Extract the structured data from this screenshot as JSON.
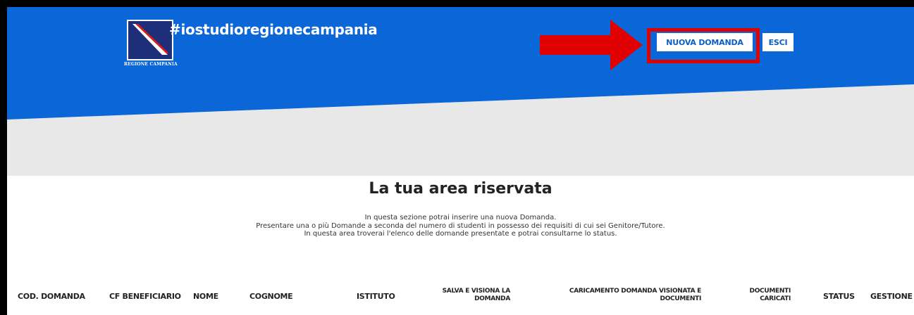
{
  "header": {
    "logo_text": "REGIONE CAMPANIA",
    "hashtag": "#iostudioregionecampania",
    "buttons": {
      "nuova_domanda": "NUOVA DOMANDA",
      "esci": "ESCI"
    }
  },
  "main": {
    "title": "La tua area riservata",
    "intro_lines": [
      "In questa sezione potrai inserire una nuova Domanda.",
      "Presentare una o più Domande a seconda del numero di studenti in possesso dei requisiti di cui sei Genitore/Tutore.",
      "In questa area troverai l'elenco delle domande presentate e potrai consultarne lo status."
    ]
  },
  "table": {
    "columns": {
      "cod_domanda": "COD. DOMANDA",
      "cf_beneficiario": "CF BENEFICIARIO",
      "nome": "NOME",
      "cognome": "COGNOME",
      "istituto": "ISTITUTO",
      "salva_l1": "SALVA E VISIONA LA",
      "salva_l2": "DOMANDA",
      "caricamento_l1": "CARICAMENTO DOMANDA VISIONATA E",
      "caricamento_l2": "DOCUMENTI",
      "documenti_l1": "DOCUMENTI",
      "documenti_l2": "CARICATI",
      "status": "STATUS",
      "gestione": "GESTIONE"
    }
  },
  "colors": {
    "header_blue": "#0b67d8",
    "band_grey": "#e8e8e8",
    "highlight_red": "#e00000",
    "button_text": "#0b5fc4"
  },
  "icons": {
    "logo": "regione-campania-coat-of-arms",
    "annotation": "red-arrow-right"
  }
}
